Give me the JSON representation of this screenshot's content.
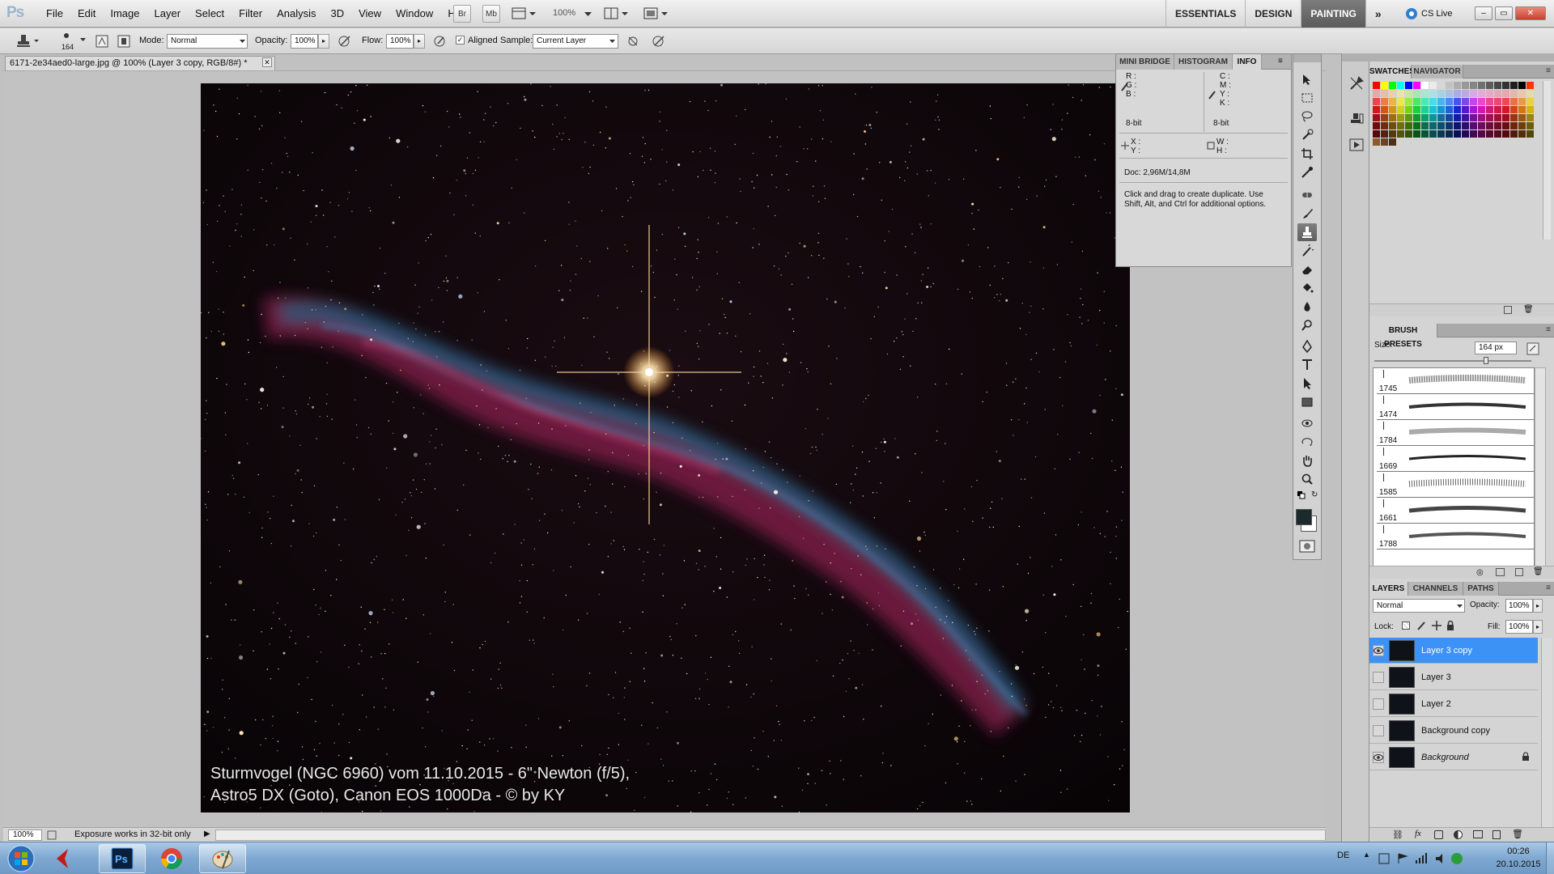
{
  "app": {
    "logo": "Ps"
  },
  "menus": [
    "File",
    "Edit",
    "Image",
    "Layer",
    "Select",
    "Filter",
    "Analysis",
    "3D",
    "View",
    "Window",
    "Help"
  ],
  "app_bar": {
    "bridge": "Br",
    "minibridge": "Mb",
    "zoom": "100%"
  },
  "workspaces": {
    "items": [
      "ESSENTIALS",
      "DESIGN",
      "PAINTING"
    ],
    "active": "PAINTING",
    "cs_live": "CS Live"
  },
  "options_bar": {
    "brush_size": "164",
    "mode_label": "Mode:",
    "mode_value": "Normal",
    "opacity_label": "Opacity:",
    "opacity_value": "100%",
    "flow_label": "Flow:",
    "flow_value": "100%",
    "aligned_label": "Aligned",
    "sample_label": "Sample:",
    "sample_value": "Current Layer"
  },
  "document": {
    "tab_title": "6171-2e34aed0-large.jpg @ 100% (Layer 3 copy, RGB/8#) *",
    "caption_line1": "Sturmvogel (NGC 6960) vom 11.10.2015 - 6\" Newton (f/5),",
    "caption_line2": "Astro5 DX (Goto), Canon EOS 1000Da - © by KY"
  },
  "status_bar": {
    "zoom": "100%",
    "message": "Exposure works in 32-bit only"
  },
  "info_panel": {
    "tabs": [
      "MINI BRIDGE",
      "HISTOGRAM",
      "INFO"
    ],
    "active_tab": "INFO",
    "rgb_labels": [
      "R :",
      "G :",
      "B :"
    ],
    "cmyk_labels": [
      "C :",
      "M :",
      "Y :",
      "K :"
    ],
    "bit_left": "8-bit",
    "bit_right": "8-bit",
    "xy_labels": [
      "X :",
      "Y :"
    ],
    "wh_labels": [
      "W :",
      "H :"
    ],
    "doc_size": "Doc: 2,96M/14,8M",
    "hint": "Click and drag to create duplicate.  Use Shift, Alt, and Ctrl for additional options."
  },
  "swatches_panel": {
    "tabs": [
      "SWATCHES",
      "NAVIGATOR"
    ],
    "active_tab": "SWATCHES"
  },
  "brush_presets": {
    "title": "BRUSH PRESETS",
    "size_label": "Size:",
    "size_value": "164 px",
    "size_fraction": 0.72,
    "brushes": [
      "1745",
      "1474",
      "1784",
      "1669",
      "1585",
      "1661",
      "1788"
    ]
  },
  "layers_panel": {
    "tabs": [
      "LAYERS",
      "CHANNELS",
      "PATHS"
    ],
    "active_tab": "LAYERS",
    "blend_mode": "Normal",
    "opacity_label": "Opacity:",
    "opacity_value": "100%",
    "lock_label": "Lock:",
    "fill_label": "Fill:",
    "fill_value": "100%",
    "layers": [
      {
        "name": "Layer 3 copy",
        "visible": true,
        "selected": true,
        "italic": false
      },
      {
        "name": "Layer 3",
        "visible": false,
        "selected": false,
        "italic": false
      },
      {
        "name": "Layer 2",
        "visible": false,
        "selected": false,
        "italic": false
      },
      {
        "name": "Background copy",
        "visible": false,
        "selected": false,
        "italic": false
      },
      {
        "name": "Background",
        "visible": true,
        "selected": false,
        "italic": true
      }
    ]
  },
  "taskbar": {
    "lang": "DE",
    "time": "00:26",
    "date": "20.10.2015"
  },
  "colors": {
    "selection": "#3d92f5",
    "foreground": "#1d2a2c",
    "background": "#ffffff",
    "workspace_active": "#5b5b5b"
  }
}
